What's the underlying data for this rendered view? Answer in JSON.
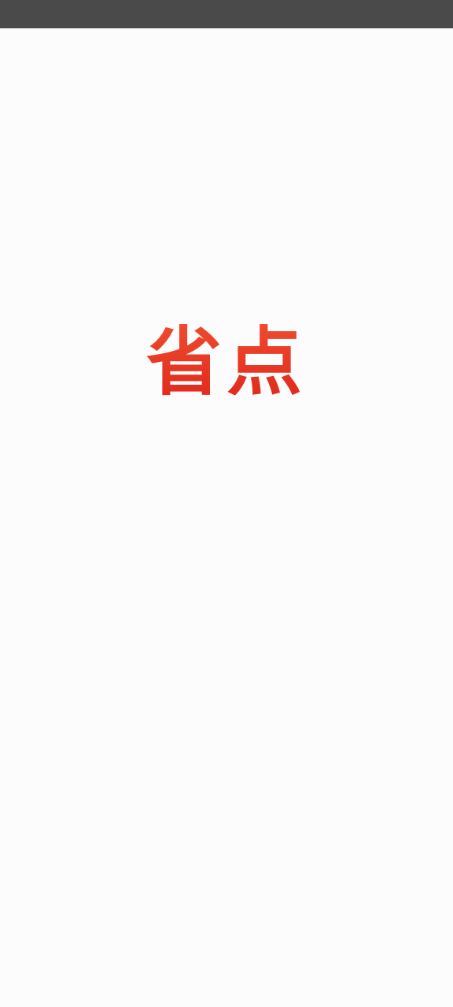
{
  "app": {
    "logo_text": "省点"
  },
  "colors": {
    "status_bar": "#4a4a4a",
    "background": "#fcfcfc",
    "logo_red": "#e63b22"
  }
}
